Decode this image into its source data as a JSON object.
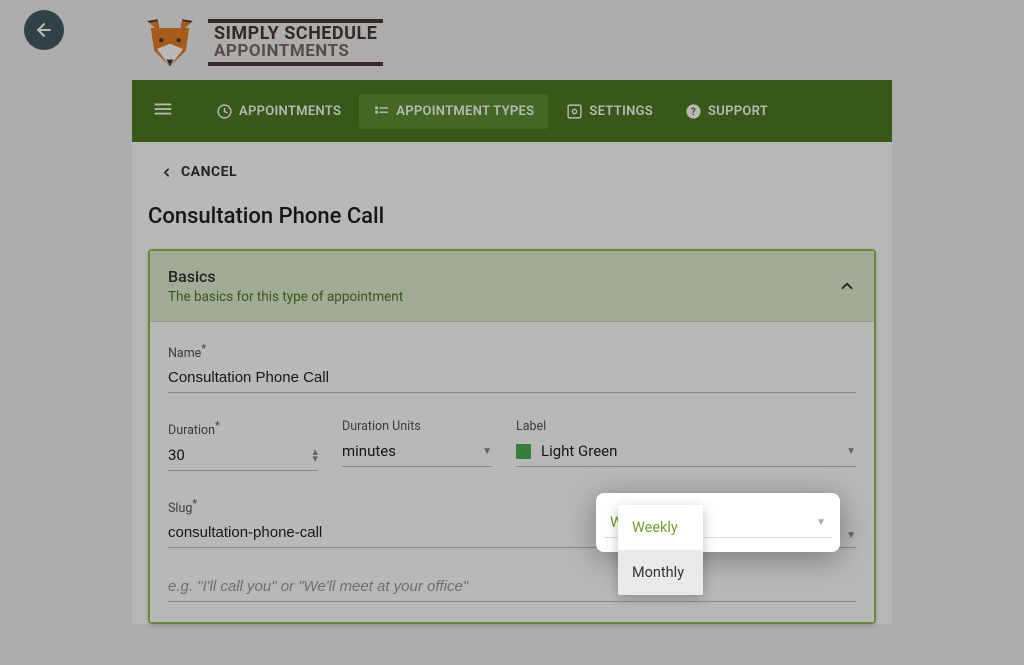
{
  "logo": {
    "line1": "SIMPLY SCHEDULE",
    "line2": "APPOINTMENTS"
  },
  "nav": {
    "appointments": "APPOINTMENTS",
    "appointment_types": "APPOINTMENT TYPES",
    "settings": "SETTINGS",
    "support": "SUPPORT"
  },
  "cancel_label": "CANCEL",
  "page_title": "Consultation Phone Call",
  "panel": {
    "title": "Basics",
    "subtitle": "The basics for this type of appointment"
  },
  "fields": {
    "name_label": "Name",
    "name_value": "Consultation Phone Call",
    "duration_label": "Duration",
    "duration_value": "30",
    "duration_units_label": "Duration Units",
    "duration_units_value": "minutes",
    "label_label": "Label",
    "label_value": "Light Green",
    "slug_label": "Slug",
    "slug_value": "consultation-phone-call",
    "location_placeholder": "e.g. \"I'll call you\" or \"We'll meet at your office\""
  },
  "dropdown": {
    "selected": "Weekly",
    "options": [
      "Weekly",
      "Monthly"
    ]
  },
  "colors": {
    "brand_green": "#4d7a21",
    "accent_green": "#6fa02a",
    "swatch": "#4caf50"
  }
}
